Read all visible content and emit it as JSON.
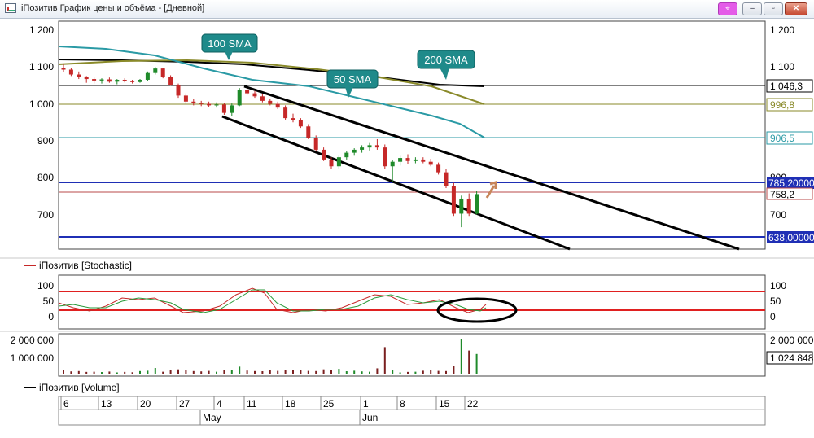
{
  "window": {
    "title": "iПозитив График цены и объёма - [Дневной]",
    "buttons": {
      "pin": "⌖",
      "minimize": "–",
      "maximize": "▫",
      "close": "✕"
    }
  },
  "price_panel": {
    "y_ticks_left": [
      "1 200",
      "1 100",
      "1 000",
      "900",
      "800",
      "700"
    ],
    "y_ticks_right": [
      "1 200",
      "1 100",
      "1 000",
      "900",
      "800",
      "700"
    ],
    "annotations": {
      "sma100": "100 SMA",
      "sma50": "50 SMA",
      "sma200": "200 SMA"
    },
    "level_labels": {
      "sma200": "1 046,3",
      "sma100": "996,8",
      "sma50": "906,5",
      "resistance": "785,20000",
      "last": "758,2",
      "support": "638,00000"
    },
    "colors": {
      "sma50": "#2a9aa5",
      "sma100": "#8a8a2a",
      "sma200": "#000000",
      "resistance": "#1f2fb5",
      "support": "#1f2fb5",
      "last": "#b94a4a",
      "up": "#1f8a2a",
      "down": "#c62828"
    }
  },
  "stochastic_panel": {
    "legend": "iПозитив [Stochastic]",
    "y_ticks_left": [
      "100",
      "50",
      "0"
    ],
    "y_ticks_right": [
      "100",
      "50",
      "0"
    ]
  },
  "volume_panel": {
    "legend": "iПозитив [Volume]",
    "y_ticks_left": [
      "2 000 000",
      "1 000 000"
    ],
    "y_ticks_right": [
      "2 000 000",
      "1 024 848"
    ]
  },
  "time_axis": {
    "days": [
      "6",
      "13",
      "20",
      "27",
      "4",
      "11",
      "18",
      "25",
      "1",
      "8",
      "15",
      "22"
    ],
    "months": [
      "May",
      "Jun"
    ]
  },
  "chart_data": {
    "type": "candlestick",
    "y_range": [
      640,
      1220
    ],
    "candles": [
      {
        "o": 1100,
        "h": 1110,
        "l": 1088,
        "c": 1095
      },
      {
        "o": 1095,
        "h": 1100,
        "l": 1078,
        "c": 1082
      },
      {
        "o": 1082,
        "h": 1090,
        "l": 1070,
        "c": 1075
      },
      {
        "o": 1075,
        "h": 1078,
        "l": 1060,
        "c": 1070
      },
      {
        "o": 1070,
        "h": 1074,
        "l": 1058,
        "c": 1066
      },
      {
        "o": 1066,
        "h": 1072,
        "l": 1058,
        "c": 1069
      },
      {
        "o": 1069,
        "h": 1074,
        "l": 1060,
        "c": 1063
      },
      {
        "o": 1063,
        "h": 1070,
        "l": 1056,
        "c": 1068
      },
      {
        "o": 1068,
        "h": 1072,
        "l": 1061,
        "c": 1064
      },
      {
        "o": 1064,
        "h": 1068,
        "l": 1058,
        "c": 1062
      },
      {
        "o": 1062,
        "h": 1070,
        "l": 1060,
        "c": 1068
      },
      {
        "o": 1068,
        "h": 1090,
        "l": 1064,
        "c": 1086
      },
      {
        "o": 1086,
        "h": 1102,
        "l": 1082,
        "c": 1098
      },
      {
        "o": 1098,
        "h": 1100,
        "l": 1072,
        "c": 1076
      },
      {
        "o": 1076,
        "h": 1080,
        "l": 1052,
        "c": 1055
      },
      {
        "o": 1055,
        "h": 1058,
        "l": 1020,
        "c": 1026
      },
      {
        "o": 1026,
        "h": 1032,
        "l": 1004,
        "c": 1010
      },
      {
        "o": 1010,
        "h": 1018,
        "l": 1000,
        "c": 1006
      },
      {
        "o": 1006,
        "h": 1012,
        "l": 998,
        "c": 1004
      },
      {
        "o": 1004,
        "h": 1010,
        "l": 995,
        "c": 1000
      },
      {
        "o": 1000,
        "h": 1008,
        "l": 994,
        "c": 1002
      },
      {
        "o": 1002,
        "h": 1006,
        "l": 975,
        "c": 980
      },
      {
        "o": 980,
        "h": 1005,
        "l": 972,
        "c": 1000
      },
      {
        "o": 1000,
        "h": 1046,
        "l": 998,
        "c": 1042
      },
      {
        "o": 1042,
        "h": 1046,
        "l": 1028,
        "c": 1032
      },
      {
        "o": 1032,
        "h": 1038,
        "l": 1020,
        "c": 1024
      },
      {
        "o": 1024,
        "h": 1030,
        "l": 1008,
        "c": 1012
      },
      {
        "o": 1012,
        "h": 1018,
        "l": 1000,
        "c": 1004
      },
      {
        "o": 1004,
        "h": 1010,
        "l": 990,
        "c": 994
      },
      {
        "o": 994,
        "h": 1000,
        "l": 962,
        "c": 966
      },
      {
        "o": 966,
        "h": 978,
        "l": 955,
        "c": 960
      },
      {
        "o": 960,
        "h": 966,
        "l": 940,
        "c": 944
      },
      {
        "o": 944,
        "h": 950,
        "l": 910,
        "c": 914
      },
      {
        "o": 914,
        "h": 920,
        "l": 878,
        "c": 882
      },
      {
        "o": 882,
        "h": 888,
        "l": 852,
        "c": 856
      },
      {
        "o": 856,
        "h": 862,
        "l": 832,
        "c": 838
      },
      {
        "o": 838,
        "h": 866,
        "l": 832,
        "c": 862
      },
      {
        "o": 862,
        "h": 878,
        "l": 856,
        "c": 874
      },
      {
        "o": 874,
        "h": 886,
        "l": 866,
        "c": 882
      },
      {
        "o": 882,
        "h": 894,
        "l": 874,
        "c": 888
      },
      {
        "o": 888,
        "h": 900,
        "l": 880,
        "c": 894
      },
      {
        "o": 894,
        "h": 910,
        "l": 882,
        "c": 888
      },
      {
        "o": 888,
        "h": 896,
        "l": 832,
        "c": 838
      },
      {
        "o": 838,
        "h": 854,
        "l": 796,
        "c": 850
      },
      {
        "o": 850,
        "h": 866,
        "l": 840,
        "c": 860
      },
      {
        "o": 860,
        "h": 870,
        "l": 844,
        "c": 852
      },
      {
        "o": 852,
        "h": 862,
        "l": 846,
        "c": 856
      },
      {
        "o": 856,
        "h": 862,
        "l": 846,
        "c": 850
      },
      {
        "o": 850,
        "h": 858,
        "l": 838,
        "c": 842
      },
      {
        "o": 842,
        "h": 848,
        "l": 816,
        "c": 822
      },
      {
        "o": 822,
        "h": 830,
        "l": 780,
        "c": 786
      },
      {
        "o": 786,
        "h": 794,
        "l": 706,
        "c": 712
      },
      {
        "o": 712,
        "h": 760,
        "l": 676,
        "c": 752
      },
      {
        "o": 752,
        "h": 766,
        "l": 706,
        "c": 712
      },
      {
        "o": 712,
        "h": 772,
        "l": 710,
        "c": 764
      }
    ],
    "volume": [
      250000,
      180000,
      200000,
      150000,
      160000,
      140000,
      170000,
      120000,
      150000,
      130000,
      200000,
      220000,
      380000,
      160000,
      250000,
      300000,
      280000,
      200000,
      180000,
      210000,
      160000,
      240000,
      260000,
      460000,
      230000,
      200000,
      190000,
      250000,
      210000,
      240000,
      260000,
      280000,
      210000,
      200000,
      300000,
      280000,
      330000,
      190000,
      220000,
      180000,
      160000,
      360000,
      1600000,
      260000,
      120000,
      150000,
      160000,
      220000,
      280000,
      210000,
      200000,
      480000,
      2050000,
      1400000,
      1200000
    ]
  }
}
